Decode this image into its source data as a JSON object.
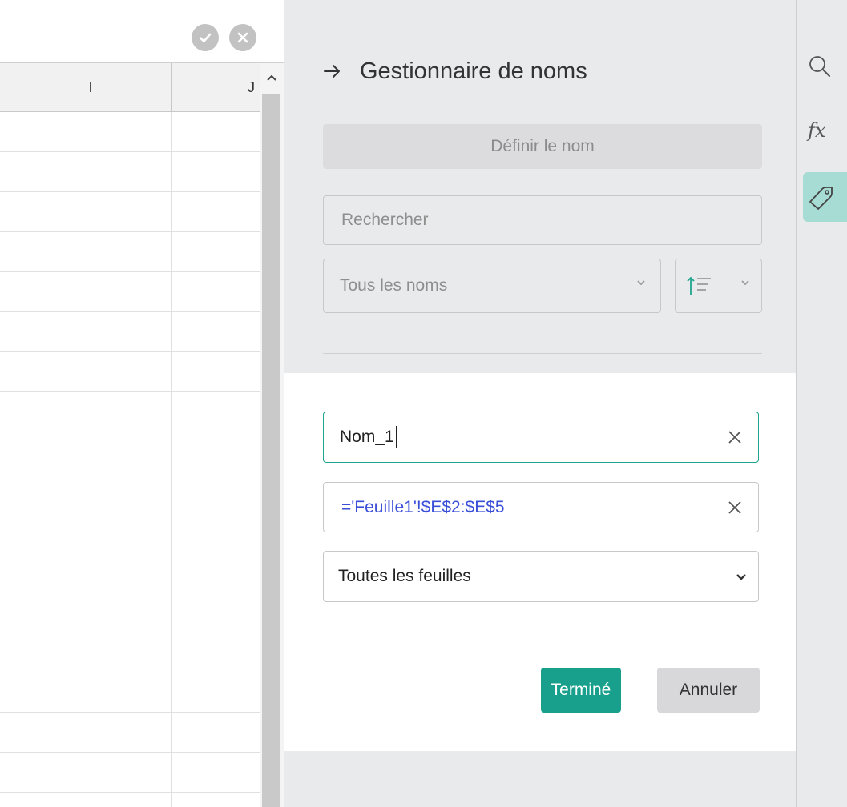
{
  "sheet": {
    "columns": [
      "I",
      "J"
    ],
    "row_count": 18
  },
  "panel": {
    "title": "Gestionnaire de noms",
    "define_name_label": "Définir le nom",
    "search_placeholder": "Rechercher",
    "filter_value": "Tous les noms"
  },
  "editor": {
    "name_value": "Nom_1",
    "reference_value": "='Feuille1'!$E$2:$E$5",
    "scope_value": "Toutes les feuilles",
    "done_label": "Terminé",
    "cancel_label": "Annuler"
  },
  "rail": {
    "fx_label": "fx",
    "icons": [
      "search-icon",
      "fx-icon",
      "tag-icon"
    ]
  },
  "colors": {
    "accent": "#18a08d",
    "active_border": "#20a38f",
    "reference_text": "#3a4fd8",
    "rail_active": "#a7dcd4",
    "panel_bg": "#e9eaec"
  }
}
